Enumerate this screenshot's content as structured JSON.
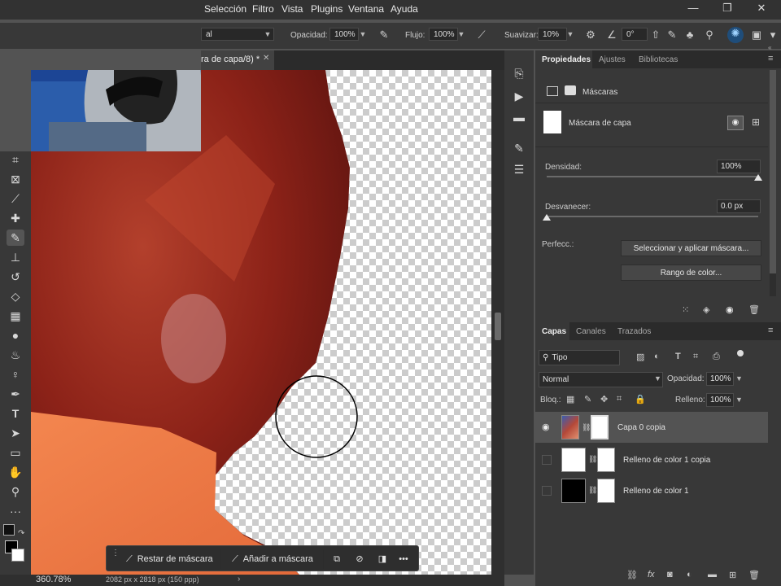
{
  "menubar": {
    "items": [
      "Selección",
      "Filtro",
      "Vista",
      "Plugins",
      "Ventana",
      "Ayuda"
    ],
    "window_controls": {
      "minimize": "—",
      "restore": "❐",
      "close": "✕"
    }
  },
  "options": {
    "mode_value": "al",
    "opacity_label": "Opacidad:",
    "opacity_value": "100%",
    "flow_label": "Flujo:",
    "flow_value": "100%",
    "smooth_label": "Suavizar:",
    "smooth_value": "10%",
    "angle_value": "0°"
  },
  "document_tab": {
    "title": "ra de capa/8) *",
    "close": "✕"
  },
  "canvas": {
    "brush_cursor": "circle"
  },
  "context_bar": {
    "subtract_label": "Restar de máscara",
    "add_label": "Añadir a máscara",
    "more": "•••"
  },
  "status": {
    "zoom": "360.78%",
    "doc_info": "2082 px x 2818 px (150 ppp)"
  },
  "properties": {
    "tabs": [
      "Propiedades",
      "Ajustes",
      "Bibliotecas"
    ],
    "section_label": "Máscaras",
    "mask_label": "Máscara de capa",
    "density_label": "Densidad:",
    "density_value": "100%",
    "density_fraction": 1.0,
    "feather_label": "Desvanecer:",
    "feather_value": "0.0 px",
    "feather_fraction": 0.0,
    "refine_label": "Perfecc.:",
    "select_mask_button": "Seleccionar y aplicar máscara...",
    "color_range_button": "Rango de color..."
  },
  "layers": {
    "tabs": [
      "Capas",
      "Canales",
      "Trazados"
    ],
    "filter_kind": "Tipo",
    "blend_mode": "Normal",
    "opacity_label": "Opacidad:",
    "opacity_value": "100%",
    "lock_label": "Bloq.:",
    "fill_label": "Relleno:",
    "fill_value": "100%",
    "items": [
      {
        "name": "Capa 0 copia",
        "visible": true,
        "selected": true
      },
      {
        "name": "Relleno de color 1 copia",
        "visible": false,
        "selected": false
      },
      {
        "name": "Relleno de color 1",
        "visible": false,
        "selected": false
      }
    ]
  },
  "colors": {
    "accent": "#2d8ceb",
    "panel": "#383838",
    "app_bg": "#535353",
    "selected_row": "#535353"
  }
}
